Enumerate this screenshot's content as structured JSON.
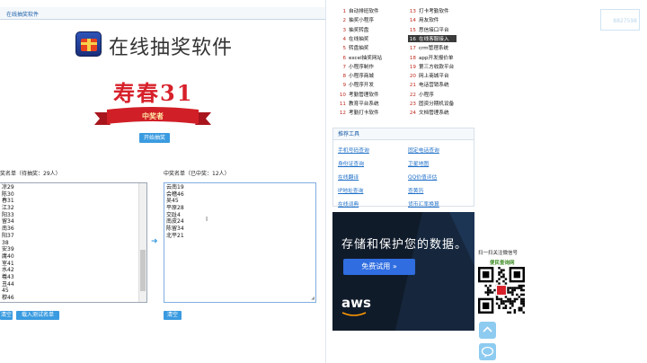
{
  "breadcrumb": "在线抽奖软件",
  "app": {
    "title": "在线抽奖软件",
    "current_winner": "寿春31",
    "ribbon_label": "中奖者",
    "start_button": "开始抽奖"
  },
  "candidates": {
    "label": "奖名单（待抽奖：29人）",
    "items": [
      "凉29",
      "陈30",
      "春31",
      "江32",
      "阳33",
      "留34",
      "南36",
      "阳37",
      "38",
      "安39",
      "庸40",
      "室41",
      "水42",
      "羲43",
      "丑44",
      "45",
      "穆46"
    ],
    "clear_button": "清空",
    "import_button": "载入测试名单"
  },
  "winners": {
    "label": "中奖名单（已中奖：12人）",
    "items": [
      "云南19",
      "会稽46",
      "吴45",
      "平原28",
      "交趾4",
      "南皮24",
      "陈留34",
      "北平21"
    ],
    "clear_button": "清空"
  },
  "menu": {
    "left": [
      {
        "num": "1",
        "label": "自动排班软件"
      },
      {
        "num": "2",
        "label": "抽奖小程序"
      },
      {
        "num": "3",
        "label": "抽奖转盘"
      },
      {
        "num": "4",
        "label": "在线抽奖"
      },
      {
        "num": "5",
        "label": "转盘抽奖"
      },
      {
        "num": "6",
        "label": "excel抽奖网站"
      },
      {
        "num": "7",
        "label": "小程序制作"
      },
      {
        "num": "8",
        "label": "小程序商城"
      },
      {
        "num": "9",
        "label": "小程序开发"
      },
      {
        "num": "10",
        "label": "考勤管理软件"
      },
      {
        "num": "11",
        "label": "教育平台系统"
      },
      {
        "num": "12",
        "label": "考勤打卡软件"
      }
    ],
    "right": [
      {
        "num": "13",
        "label": "打卡考勤软件"
      },
      {
        "num": "14",
        "label": "用友软件"
      },
      {
        "num": "15",
        "label": "思信接口平台"
      },
      {
        "num": "16",
        "label": "在线客服接入"
      },
      {
        "num": "17",
        "label": "crm管理系统"
      },
      {
        "num": "18",
        "label": "app开发报价单"
      },
      {
        "num": "19",
        "label": "第三方收款平台"
      },
      {
        "num": "20",
        "label": "网上商城平台"
      },
      {
        "num": "21",
        "label": "电话营销系统"
      },
      {
        "num": "22",
        "label": "小程序"
      },
      {
        "num": "23",
        "label": "固资分期机设备"
      },
      {
        "num": "24",
        "label": "文档管理系统"
      }
    ]
  },
  "tools": {
    "header": "推荐工具",
    "links": [
      "手机号码查询",
      "固定电话查询",
      "身份证查询",
      "卫星地图",
      "在线翻译",
      "QQ价值评估",
      "IP地址查询",
      "查黄历",
      "在线词典",
      "货币汇率换算"
    ]
  },
  "ad": {
    "headline": "存储和保护您的数据。",
    "button": "免费试用 »",
    "brand": "aws",
    "close": "✕"
  },
  "sidebar": {
    "qr_caption": "扫一扫关注微信号",
    "qr_name": "便民查询网",
    "corner_text": "8827598"
  },
  "colors": {
    "accent": "#3a9be0",
    "winner_red": "#d7202a",
    "link": "#1e6fc8"
  }
}
